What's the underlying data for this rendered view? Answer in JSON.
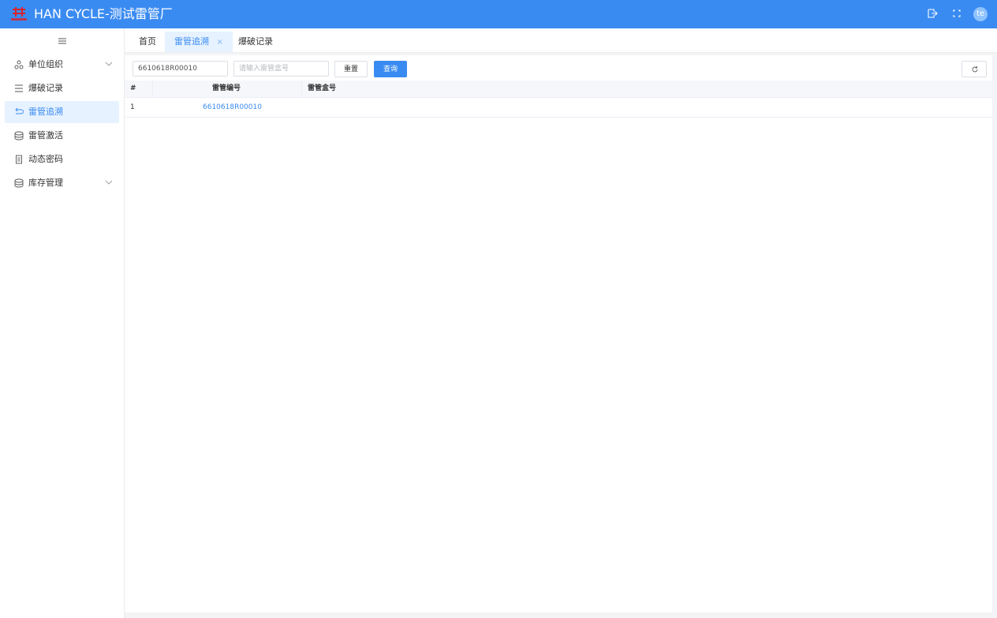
{
  "header": {
    "title": "HAN CYCLE-测试雷管厂",
    "avatar_text": "te",
    "accent": "#3a8bf1",
    "icons": [
      "logout-icon",
      "fullscreen-icon"
    ]
  },
  "sidebar": {
    "items": [
      {
        "label": "单位组织",
        "icon": "org-icon",
        "expandable": true
      },
      {
        "label": "爆破记录",
        "icon": "list-icon",
        "expandable": false
      },
      {
        "label": "雷管追溯",
        "icon": "trace-icon",
        "expandable": false,
        "active": true
      },
      {
        "label": "雷管激活",
        "icon": "database-icon",
        "expandable": false
      },
      {
        "label": "动态密码",
        "icon": "document-icon",
        "expandable": false
      },
      {
        "label": "库存管理",
        "icon": "database-icon",
        "expandable": true
      }
    ]
  },
  "tabs": [
    {
      "label": "首页"
    },
    {
      "label": "雷管追溯",
      "closable": true,
      "active": true,
      "close_glyph": "×"
    },
    {
      "label": "爆破记录"
    }
  ],
  "search": {
    "detonator_no_value": "6610618R00010",
    "box_no_placeholder": "请输入雷管盒号",
    "reset_label": "重置",
    "query_label": "查询"
  },
  "table": {
    "headers": {
      "index": "#",
      "detonator_no": "雷管编号",
      "box_no": "雷管盒号"
    },
    "rows": [
      {
        "index": "1",
        "detonator_no": "6610618R00010",
        "box_no": ""
      }
    ]
  }
}
